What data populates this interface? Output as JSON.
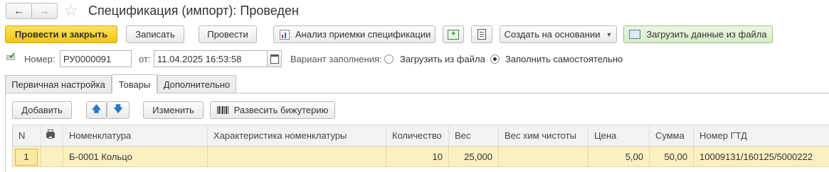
{
  "window": {
    "title": "Спецификация (импорт): Проведен"
  },
  "toolbar": {
    "post_and_close": "Провести и закрыть",
    "save": "Записать",
    "post": "Провести",
    "analysis": "Анализ приемки спецификации",
    "create_based_on": "Создать на основании",
    "load_from_file": "Загрузить данные из файла"
  },
  "header": {
    "number_label": "Номер:",
    "number_value": "РУ0000091",
    "date_label": "от:",
    "date_value": "11.04.2025 16:53:58",
    "fill_variant_label": "Вариант заполнения:",
    "fill_options": [
      "Загрузить из файла",
      "Заполнить самостоятельно"
    ],
    "fill_selected": "Заполнить самостоятельно"
  },
  "tabs": [
    {
      "label": "Первичная настройка",
      "active": false
    },
    {
      "label": "Товары",
      "active": true
    },
    {
      "label": "Дополнительно",
      "active": false
    }
  ],
  "goods_toolbar": {
    "add": "Добавить",
    "change": "Изменить",
    "weigh_jewelry": "Развесить бижутерию"
  },
  "table": {
    "columns": [
      "N",
      "",
      "Номенклатура",
      "Характеристика номенклатуры",
      "Количество",
      "Вес",
      "Вес хим чистоты",
      "Цена",
      "Сумма",
      "Номер ГТД"
    ],
    "rows": [
      {
        "n": "1",
        "print": "",
        "nomenclature": "Б-0001 Кольцо",
        "characteristic": "",
        "quantity": "10",
        "weight": "25,000",
        "purity_weight": "",
        "price": "5,00",
        "sum": "50,00",
        "gtd": "10009131/160125/5000222"
      }
    ]
  },
  "colors": {
    "primary_button": "#f2c516",
    "selected_row": "#fbf0c2",
    "table_header": "#f2f2f2"
  }
}
